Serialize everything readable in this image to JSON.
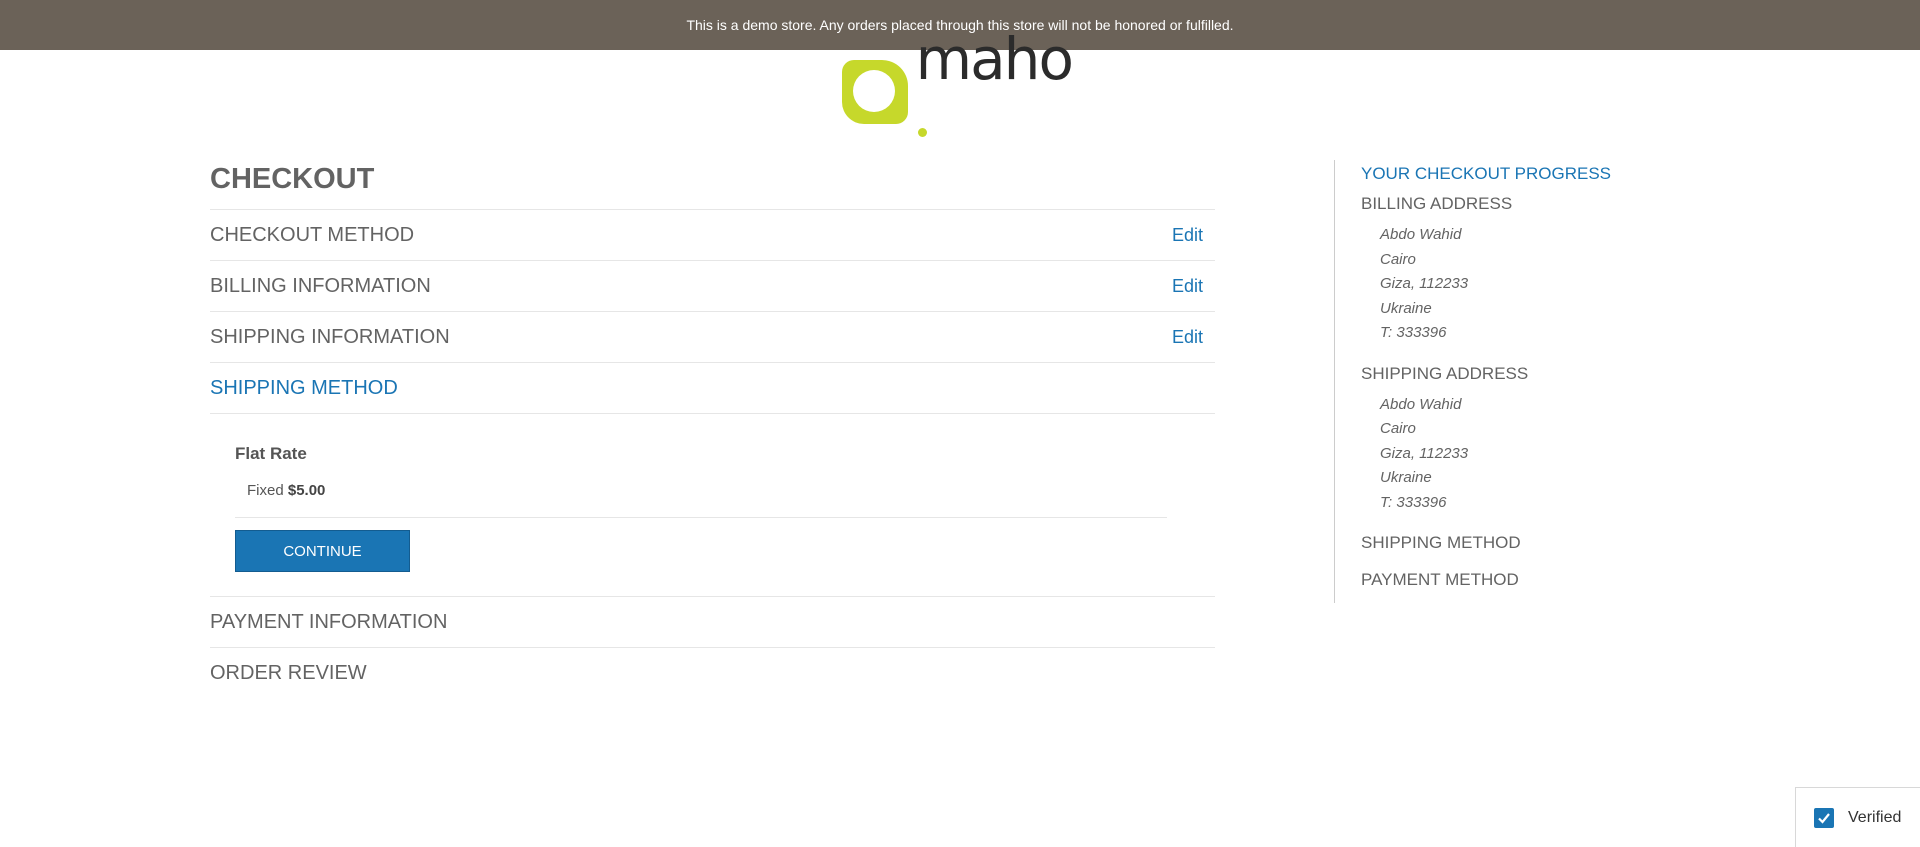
{
  "demo_notice": "This is a demo store. Any orders placed through this store will not be honored or fulfilled.",
  "logo": {
    "text": "maho",
    "colors": {
      "mark": "#c6d82b",
      "text": "#2b2b2b"
    }
  },
  "checkout": {
    "title": "CHECKOUT",
    "edit_label": "Edit",
    "steps": [
      {
        "label": "CHECKOUT METHOD",
        "has_edit": true
      },
      {
        "label": "BILLING INFORMATION",
        "has_edit": true
      },
      {
        "label": "SHIPPING INFORMATION",
        "has_edit": true
      },
      {
        "label": "SHIPPING METHOD",
        "active": true
      },
      {
        "label": "PAYMENT INFORMATION"
      },
      {
        "label": "ORDER REVIEW"
      }
    ],
    "shipping_method": {
      "carrier": "Flat Rate",
      "method": "Fixed",
      "price": "$5.00",
      "continue_label": "CONTINUE"
    }
  },
  "progress": {
    "title": "YOUR CHECKOUT PROGRESS",
    "billing_title": "BILLING ADDRESS",
    "billing_lines": [
      "Abdo Wahid",
      "Cairo",
      "Giza, 112233",
      "Ukraine",
      "T: 333396"
    ],
    "shipping_title": "SHIPPING ADDRESS",
    "shipping_lines": [
      "Abdo Wahid",
      "Cairo",
      "Giza, 112233",
      "Ukraine",
      "T: 333396"
    ],
    "shipping_method_title": "SHIPPING METHOD",
    "payment_method_title": "PAYMENT METHOD"
  },
  "verified": {
    "label": "Verified",
    "checked": true
  },
  "colors": {
    "accent": "#1a75b4",
    "banner": "#6b6258",
    "text": "#636363"
  }
}
